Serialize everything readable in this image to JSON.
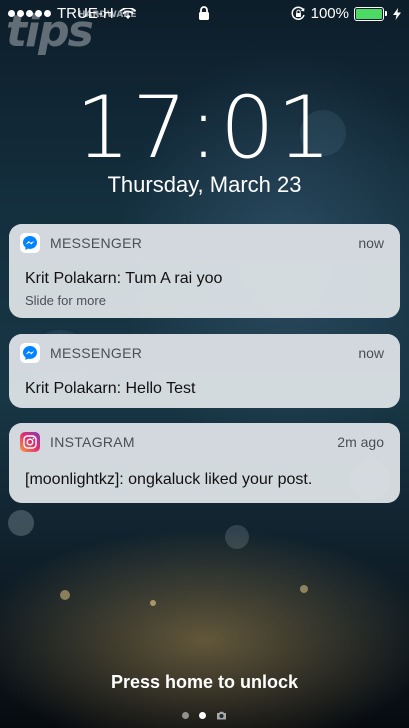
{
  "status_bar": {
    "carrier": "TRUE-H",
    "battery": "100%",
    "battery_level": 1.0,
    "icons": [
      "signal-dots-icon",
      "wifi-icon",
      "lock-icon",
      "rotation-lock-icon",
      "battery-icon",
      "charging-icon"
    ]
  },
  "watermark": {
    "text": "tips",
    "sub": "HARDWARE"
  },
  "lock_screen": {
    "time": "17:01",
    "date": "Thursday, March 23",
    "unlock_hint": "Press home to unlock",
    "pager_pages": 3
  },
  "notifications": [
    {
      "app": "MESSENGER",
      "icon": "messenger-icon",
      "when": "now",
      "message": "Krit Polakarn: Tum A rai yoo",
      "hint": "Slide for more"
    },
    {
      "app": "MESSENGER",
      "icon": "messenger-icon",
      "when": "now",
      "message": "Krit Polakarn: Hello Test"
    },
    {
      "app": "INSTAGRAM",
      "icon": "instagram-icon",
      "when": "2m ago",
      "message": "[moonlightkz]: ongkaluck liked your post."
    }
  ],
  "colors": {
    "battery_fill": "#4cd964",
    "messenger": "#0084ff",
    "instagram": "#c13584"
  }
}
